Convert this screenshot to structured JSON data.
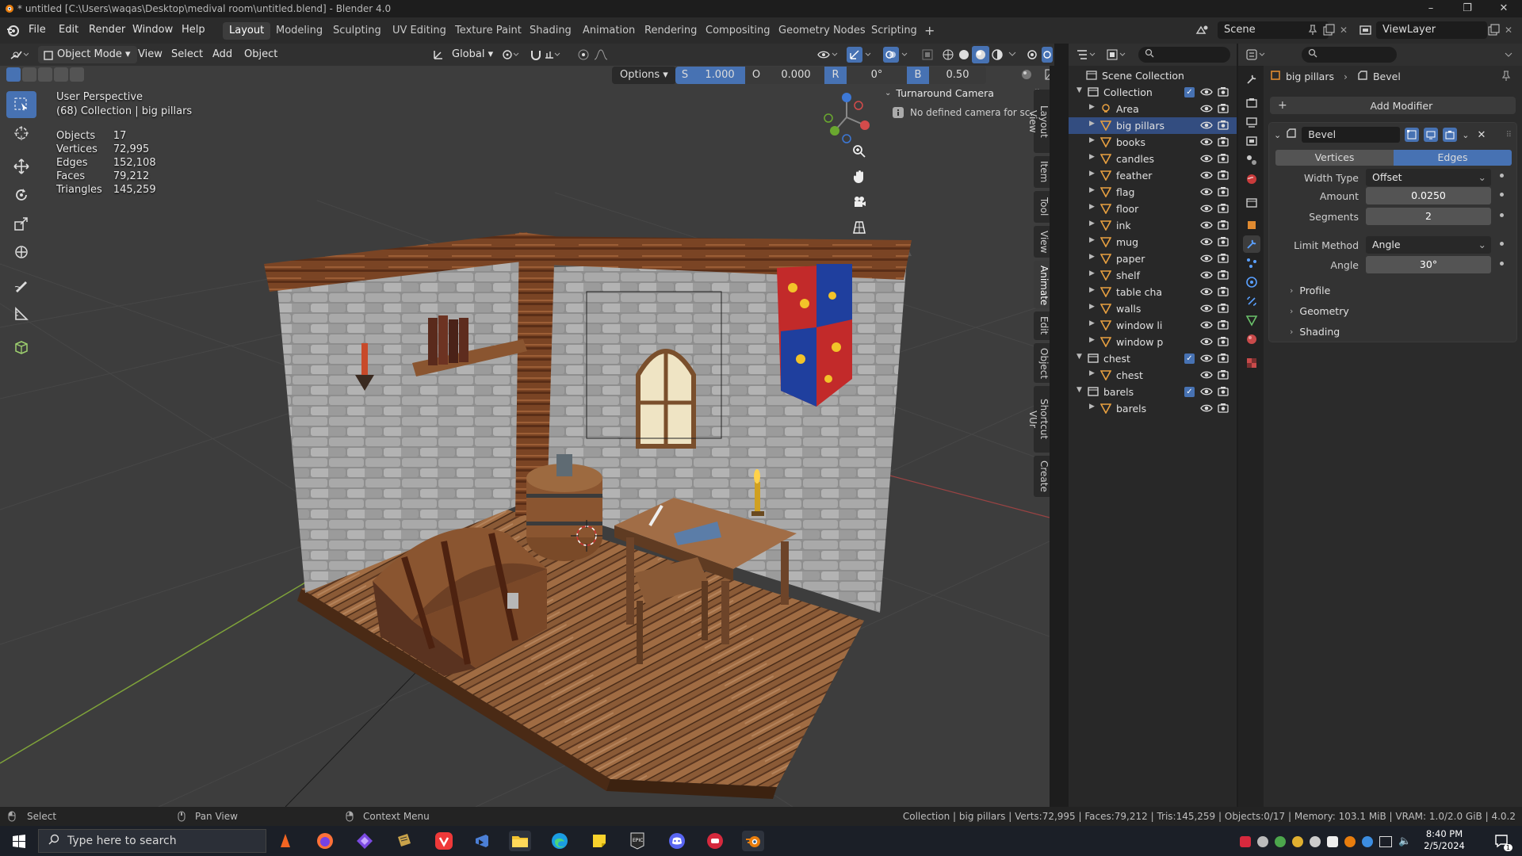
{
  "titlebar": {
    "title": "* untitled [C:\\Users\\waqas\\Desktop\\medival room\\untitled.blend] - Blender 4.0"
  },
  "menus": [
    "File",
    "Edit",
    "Render",
    "Window",
    "Help"
  ],
  "workspaces": [
    "Layout",
    "Modeling",
    "Sculpting",
    "UV Editing",
    "Texture Paint",
    "Shading",
    "Animation",
    "Rendering",
    "Compositing",
    "Geometry Nodes",
    "Scripting"
  ],
  "active_workspace": "Layout",
  "scene": {
    "scene_name": "Scene",
    "view_layer": "ViewLayer"
  },
  "viewport_header": {
    "mode": "Object Mode",
    "menus": [
      "View",
      "Select",
      "Add",
      "Object"
    ],
    "orientation": "Global",
    "options": "Options",
    "scale_label": "S",
    "scale_value": "1.000",
    "offset_label": "O",
    "offset_value": "0.000",
    "rot_label": "R",
    "rot_value": "0°",
    "bevel_label": "B",
    "bevel_value": "0.50"
  },
  "viewport": {
    "perspective": "User Perspective",
    "context": "(68) Collection | big pillars",
    "stats": [
      {
        "label": "Objects",
        "value": "17"
      },
      {
        "label": "Vertices",
        "value": "72,995"
      },
      {
        "label": "Edges",
        "value": "152,108"
      },
      {
        "label": "Faces",
        "value": "79,212"
      },
      {
        "label": "Triangles",
        "value": "145,259"
      }
    ],
    "camera_panel_title": "Turnaround Camera",
    "camera_panel_msg": "No defined camera for sc...",
    "side_tabs": [
      "Layout View",
      "Item",
      "Tool",
      "View",
      "Animate",
      "Edit",
      "Object",
      "Shortcut VUr",
      "Create"
    ]
  },
  "outliner": {
    "root": "Scene Collection",
    "rows": [
      {
        "name": "Collection",
        "level": 0,
        "type": "collection",
        "expanded": true,
        "check": true
      },
      {
        "name": "Area",
        "level": 1,
        "type": "light"
      },
      {
        "name": "big pillars",
        "level": 1,
        "type": "mesh",
        "selected": true
      },
      {
        "name": "books",
        "level": 1,
        "type": "mesh"
      },
      {
        "name": "candles",
        "level": 1,
        "type": "mesh"
      },
      {
        "name": "feather",
        "level": 1,
        "type": "mesh"
      },
      {
        "name": "flag",
        "level": 1,
        "type": "mesh"
      },
      {
        "name": "floor",
        "level": 1,
        "type": "mesh"
      },
      {
        "name": "ink",
        "level": 1,
        "type": "mesh"
      },
      {
        "name": "mug",
        "level": 1,
        "type": "mesh"
      },
      {
        "name": "paper",
        "level": 1,
        "type": "mesh"
      },
      {
        "name": "shelf",
        "level": 1,
        "type": "mesh"
      },
      {
        "name": "table cha",
        "level": 1,
        "type": "mesh"
      },
      {
        "name": "walls",
        "level": 1,
        "type": "mesh"
      },
      {
        "name": "window li",
        "level": 1,
        "type": "mesh"
      },
      {
        "name": "window p",
        "level": 1,
        "type": "mesh"
      },
      {
        "name": "chest",
        "level": 0,
        "type": "collection",
        "expanded": true,
        "check": true
      },
      {
        "name": "chest",
        "level": 1,
        "type": "mesh"
      },
      {
        "name": "barels",
        "level": 0,
        "type": "collection",
        "expanded": true,
        "check": true
      },
      {
        "name": "barels",
        "level": 1,
        "type": "mesh"
      }
    ]
  },
  "properties": {
    "breadcrumb_object": "big pillars",
    "breadcrumb_modifier": "Bevel",
    "add_modifier": "Add Modifier",
    "modifier_name": "Bevel",
    "affect_vertices": "Vertices",
    "affect_edges": "Edges",
    "width_type_label": "Width Type",
    "width_type_value": "Offset",
    "amount_label": "Amount",
    "amount_value": "0.0250",
    "segments_label": "Segments",
    "segments_value": "2",
    "limit_method_label": "Limit Method",
    "limit_method_value": "Angle",
    "angle_label": "Angle",
    "angle_value": "30°",
    "sections": [
      "Profile",
      "Geometry",
      "Shading"
    ]
  },
  "statusbar": {
    "select": "Select",
    "pan": "Pan View",
    "context": "Context Menu",
    "info": "Collection | big pillars | Verts:72,995 | Faces:79,212 | Tris:145,259 | Objects:0/17 | Memory: 103.1 MiB | VRAM: 1.0/2.0 GiB | 4.0.2"
  },
  "taskbar": {
    "search_placeholder": "Type here to search",
    "time": "8:40 PM",
    "date": "2/5/2024"
  },
  "colors": {
    "accent": "#4772b3",
    "selected_row": "#334d80",
    "viewport_bg": "#3d3d3d"
  }
}
